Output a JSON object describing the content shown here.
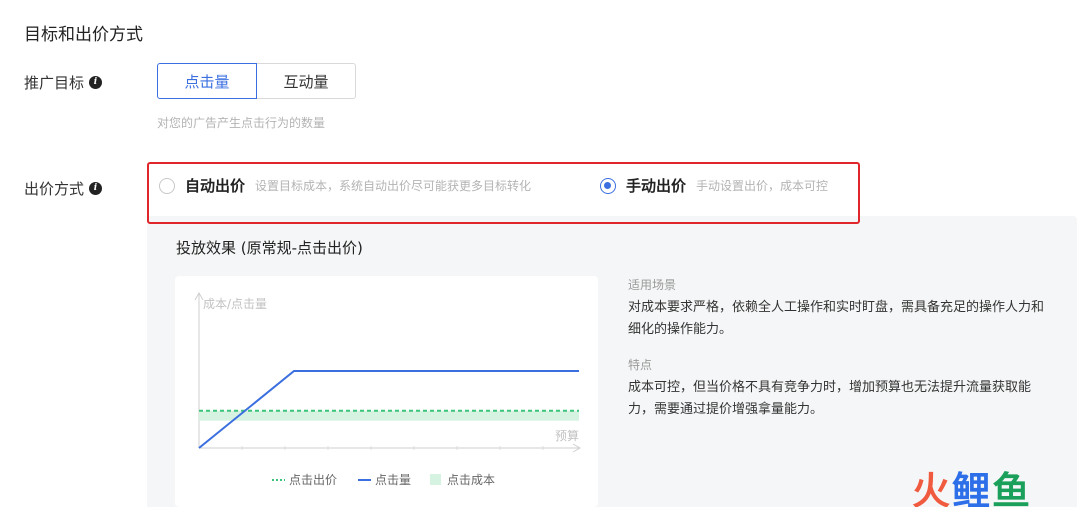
{
  "section": {
    "title": "目标和出价方式"
  },
  "promotion_goal": {
    "label": "推广目标",
    "options": [
      {
        "label": "点击量",
        "active": true
      },
      {
        "label": "互动量",
        "active": false
      }
    ],
    "hint": "对您的广告产生点击行为的数量"
  },
  "bid_method": {
    "label": "出价方式",
    "options": [
      {
        "label": "自动出价",
        "desc": "设置目标成本，系统自动出价尽可能获更多目标转化",
        "checked": false
      },
      {
        "label": "手动出价",
        "desc": "手动设置出价，成本可控",
        "checked": true
      }
    ]
  },
  "effect": {
    "title": "投放效果 (原常规-点击出价)",
    "scenario_head": "适用场景",
    "scenario_text": "对成本要求严格，依赖全人工操作和实时盯盘，需具备充足的操作人力和细化的操作能力。",
    "feature_head": "特点",
    "feature_text": "成本可控，但当价格不具有竞争力时，增加预算也无法提升流量获取能力，需要通过提价增强拿量能力。"
  },
  "chart_data": {
    "type": "line",
    "ylabel": "成本/点击量",
    "xlabel": "预算",
    "series": [
      {
        "name": "点击出价",
        "style": "dashed",
        "color": "#3cc27a",
        "points": [
          [
            0,
            0.3
          ],
          [
            1,
            0.3
          ]
        ]
      },
      {
        "name": "点击量",
        "style": "solid",
        "color": "#3b6fe0",
        "points": [
          [
            0,
            0
          ],
          [
            0.25,
            0.62
          ],
          [
            1,
            0.62
          ]
        ]
      },
      {
        "name": "点击成本",
        "style": "band",
        "color": "#d6f2e1",
        "range": [
          0.22,
          0.3
        ]
      }
    ]
  },
  "watermark": {
    "a": "火",
    "b": "鲤",
    "c": "鱼"
  }
}
